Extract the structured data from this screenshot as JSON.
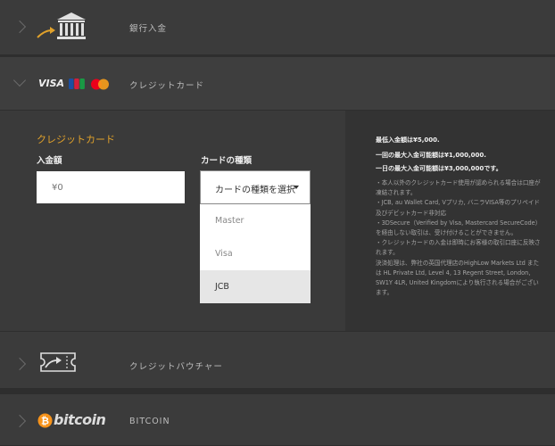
{
  "methods": {
    "bank": {
      "label": "銀行入金"
    },
    "card": {
      "label": "クレジットカード",
      "visa_logo": "VISA"
    },
    "voucher": {
      "label": "クレジットバウチャー"
    },
    "bitcoin": {
      "label": "BITCOIN",
      "logo_text": "bitcoin"
    }
  },
  "card_form": {
    "title": "クレジットカード",
    "amount_label": "入金額",
    "amount_placeholder": "¥0",
    "type_label": "カードの種類",
    "select_value": "カードの種類を選択",
    "options": [
      "Master",
      "Visa",
      "JCB"
    ]
  },
  "info": {
    "min": "最低入金額は¥5,000.",
    "max_once": "一回の最大入金可能額は¥1,000,000.",
    "max_day": "一日の最大入金可能額は¥3,000,000です。",
    "notes": [
      "・本人以外のクレジットカード使用が認められる場合は口座が凍結されます。",
      "・JCB, au Wallet Card, Vプリカ, バニラVISA等のプリペイド及びデビットカード非対応",
      "・3DSecure（Verified by Visa, Mastercard SecureCode）を経由しない取引は、受け付けることができません。",
      "・クレジットカードの入金は即時にお客様の取引口座に反映されます。",
      "決済処理は、弊社の英国代理店のHighLow Markets Ltd または HL Private Ltd, Level 4, 13 Regent Street, London, SW1Y 4LR, United Kingdomにより執行される場合がございます。"
    ]
  },
  "colors": {
    "accent": "#e0a12b",
    "bank_arrow": "#e0a12b",
    "bitcoin": "#f7931a"
  }
}
